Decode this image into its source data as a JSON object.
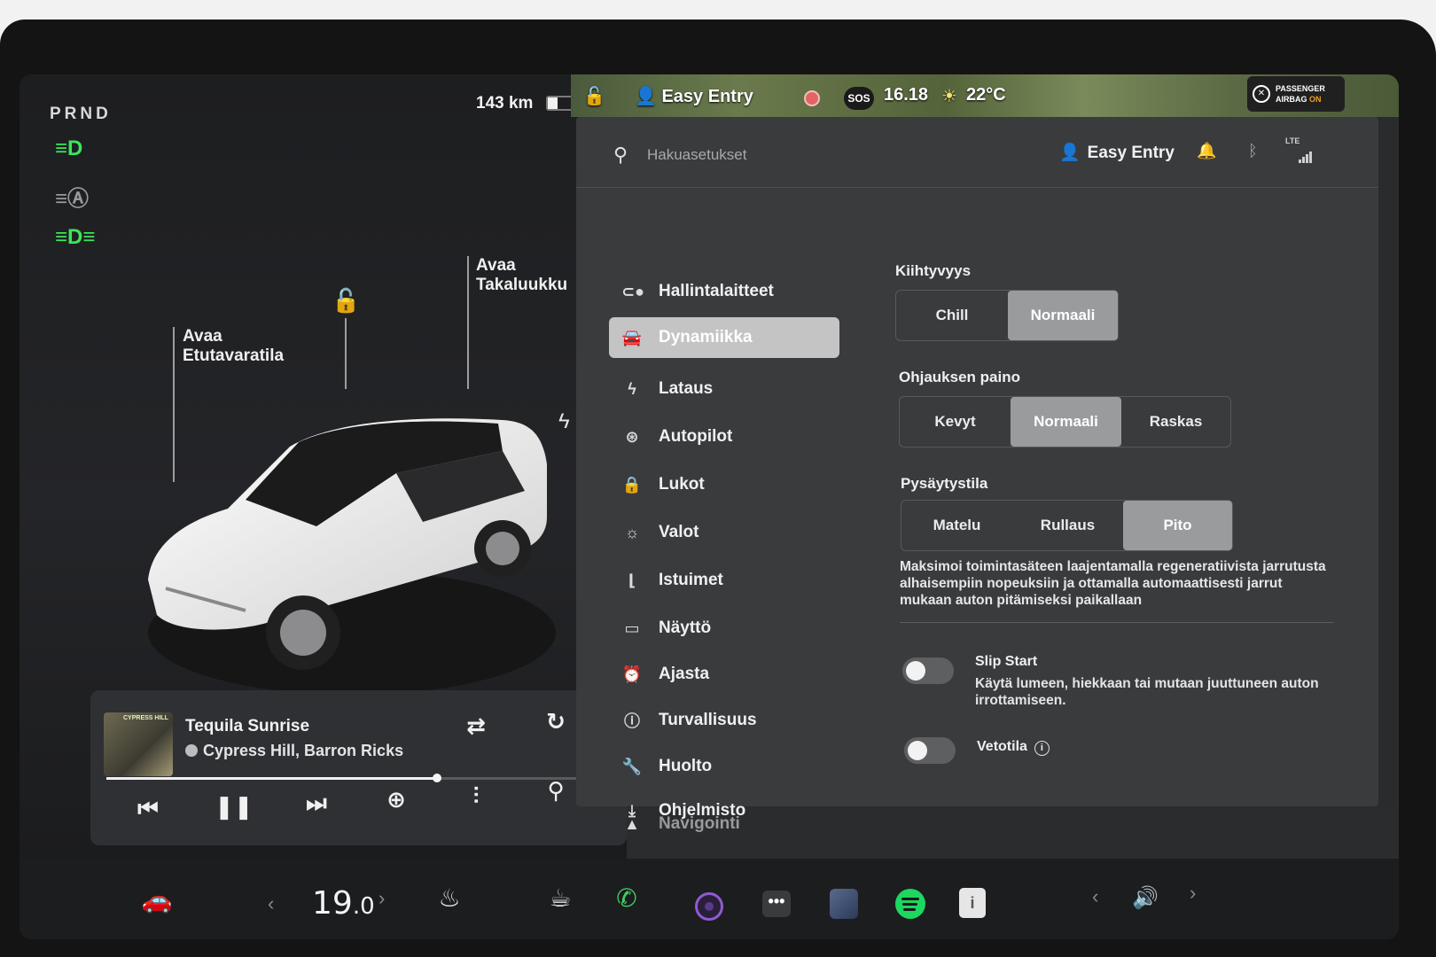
{
  "car": {
    "gear": "PRND",
    "range": "143 km",
    "battery_level": 0.3,
    "frunk": {
      "line1": "Avaa",
      "line2": "Etutavaratila"
    },
    "trunk": {
      "line1": "Avaa",
      "line2": "Takaluukku"
    }
  },
  "status_bar": {
    "profile": "Easy Entry",
    "sos": "SOS",
    "time": "16.18",
    "temperature": "22°C",
    "airbag_line1": "PASSENGER",
    "airbag_line2": "AIRBAG",
    "airbag_state": "ON"
  },
  "settings": {
    "search_placeholder": "Hakuasetukset",
    "profile": "Easy Entry",
    "signal": "LTE",
    "menu": [
      {
        "label": "Hallintalaitteet",
        "icon": "toggle-icon"
      },
      {
        "label": "Dynamiikka",
        "icon": "car-icon",
        "active": true
      },
      {
        "label": "Lataus",
        "icon": "bolt-icon"
      },
      {
        "label": "Autopilot",
        "icon": "steering-wheel-icon"
      },
      {
        "label": "Lukot",
        "icon": "lock-icon"
      },
      {
        "label": "Valot",
        "icon": "sun-icon"
      },
      {
        "label": "Istuimet",
        "icon": "seat-icon"
      },
      {
        "label": "Näyttö",
        "icon": "display-icon"
      },
      {
        "label": "Ajasta",
        "icon": "alarm-clock-icon"
      },
      {
        "label": "Turvallisuus",
        "icon": "info-circle-icon"
      },
      {
        "label": "Huolto",
        "icon": "wrench-icon"
      },
      {
        "label": "Ohjelmisto",
        "icon": "download-icon"
      },
      {
        "label": "Navigointi",
        "icon": "navigation-arrow-icon"
      }
    ],
    "acceleration": {
      "label": "Kiihtyvyys",
      "options": [
        "Chill",
        "Normaali"
      ],
      "selected": "Normaali"
    },
    "steering": {
      "label": "Ohjauksen paino",
      "options": [
        "Kevyt",
        "Normaali",
        "Raskas"
      ],
      "selected": "Normaali"
    },
    "stopping": {
      "label": "Pysäytystila",
      "options": [
        "Matelu",
        "Rullaus",
        "Pito"
      ],
      "selected": "Pito"
    },
    "stopping_desc": "Maksimoi toimintasäteen laajentamalla regeneratiivista jarrutusta alhaisempiin nopeuksiin ja ottamalla automaattisesti jarrut mukaan auton pitämiseksi paikallaan",
    "slip_start": {
      "title": "Slip Start",
      "desc": "Käytä lumeen, hiekkaan tai mutaan juuttuneen auton irrottamiseen.",
      "on": false
    },
    "traction": {
      "title": "Vetotila",
      "on": false
    }
  },
  "media": {
    "title": "Tequila Sunrise",
    "artist": "Cypress Hill, Barron Ricks",
    "album_text": "CYPRESS HILL",
    "progress": 0.66
  },
  "dock": {
    "temp_whole": "19",
    "temp_decimal": ".0"
  },
  "colors": {
    "accent_green": "#3ce65a",
    "spotify_green": "#1ed760",
    "selected_segment": "#9a9b9d",
    "airbag_on": "#f0a020"
  }
}
